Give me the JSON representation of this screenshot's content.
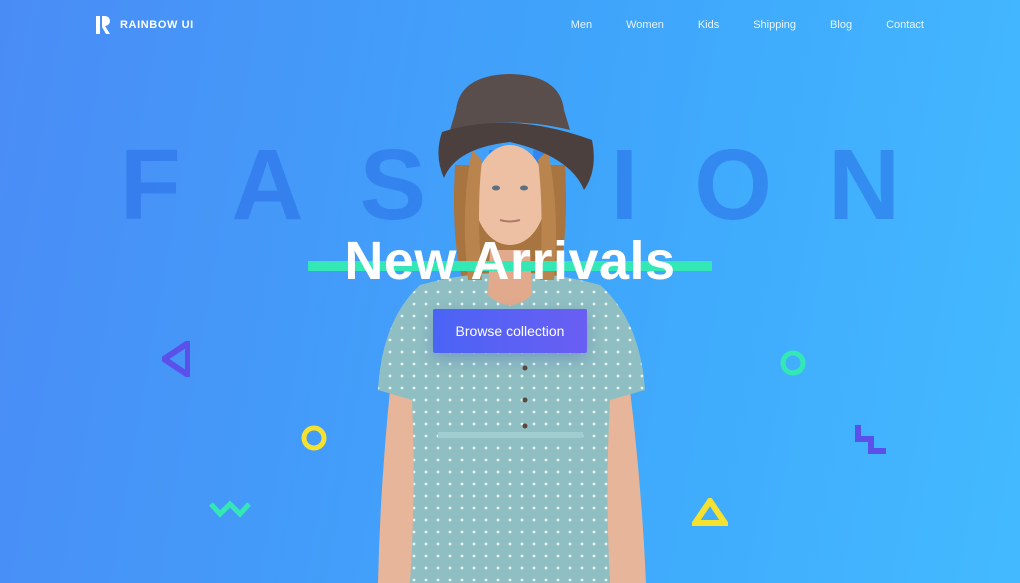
{
  "brand": {
    "name": "RAINBOW UI",
    "logo_icon": "rainbow-r-logo-icon"
  },
  "nav": {
    "items": [
      {
        "label": "Men"
      },
      {
        "label": "Women"
      },
      {
        "label": "Kids"
      },
      {
        "label": "Shipping"
      },
      {
        "label": "Blog"
      },
      {
        "label": "Contact"
      }
    ]
  },
  "hero": {
    "background_word": "FASHION",
    "headline": "New Arrivals",
    "cta_label": "Browse collection"
  },
  "colors": {
    "background_start": "#4a8cf6",
    "background_end": "#43baff",
    "accent_green": "#34e8b6",
    "accent_yellow": "#f5e12f",
    "accent_purple": "#5b50ea",
    "button": "#5362f4"
  },
  "decorations": [
    "triangle-left-icon",
    "ring-yellow-icon",
    "zigzag-icon",
    "ring-green-icon",
    "step-shape-icon",
    "triangle-up-icon"
  ]
}
